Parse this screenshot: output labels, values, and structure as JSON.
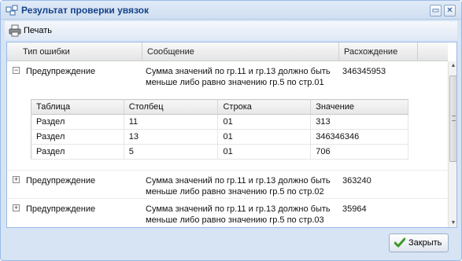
{
  "window": {
    "title": "Результат проверки увязок"
  },
  "toolbar": {
    "print_label": "Печать"
  },
  "grid": {
    "columns": [
      "Тип ошибки",
      "Сообщение",
      "Расхождение"
    ],
    "rows": [
      {
        "type": "Предупреждение",
        "message_line1": "Сумма значений по гр.11 и гр.13 должно быть",
        "message_line2": "меньше либо равно значению гр.5 по стр.01",
        "diff": "346345953",
        "expander": "−",
        "details": {
          "columns": [
            "Таблица",
            "Столбец",
            "Строка",
            "Значение"
          ],
          "rows": [
            [
              "Раздел",
              "11",
              "01",
              "313"
            ],
            [
              "Раздел",
              "13",
              "01",
              "346346346"
            ],
            [
              "Раздел",
              "5",
              "01",
              "706"
            ]
          ]
        }
      },
      {
        "type": "Предупреждение",
        "message_line1": "Сумма значений по гр.11 и гр.13 должно быть",
        "message_line2": "меньше либо равно значению гр.5 по стр.02",
        "diff": "363240",
        "expander": "+"
      },
      {
        "type": "Предупреждение",
        "message_line1": "Сумма значений по гр.11 и гр.13 должно быть",
        "message_line2": "меньше либо равно значению гр.5 по стр.03",
        "diff": "35964",
        "expander": "+"
      }
    ]
  },
  "footer": {
    "close_label": "Закрыть"
  },
  "icons": {
    "window": "window-icon",
    "print": "printer-icon",
    "restore": "restore-icon",
    "close": "close-icon",
    "confirm": "checkmark-icon"
  },
  "colors": {
    "title_text": "#15428b",
    "window_border": "#99bbe8",
    "check": "#3a9a2a"
  }
}
